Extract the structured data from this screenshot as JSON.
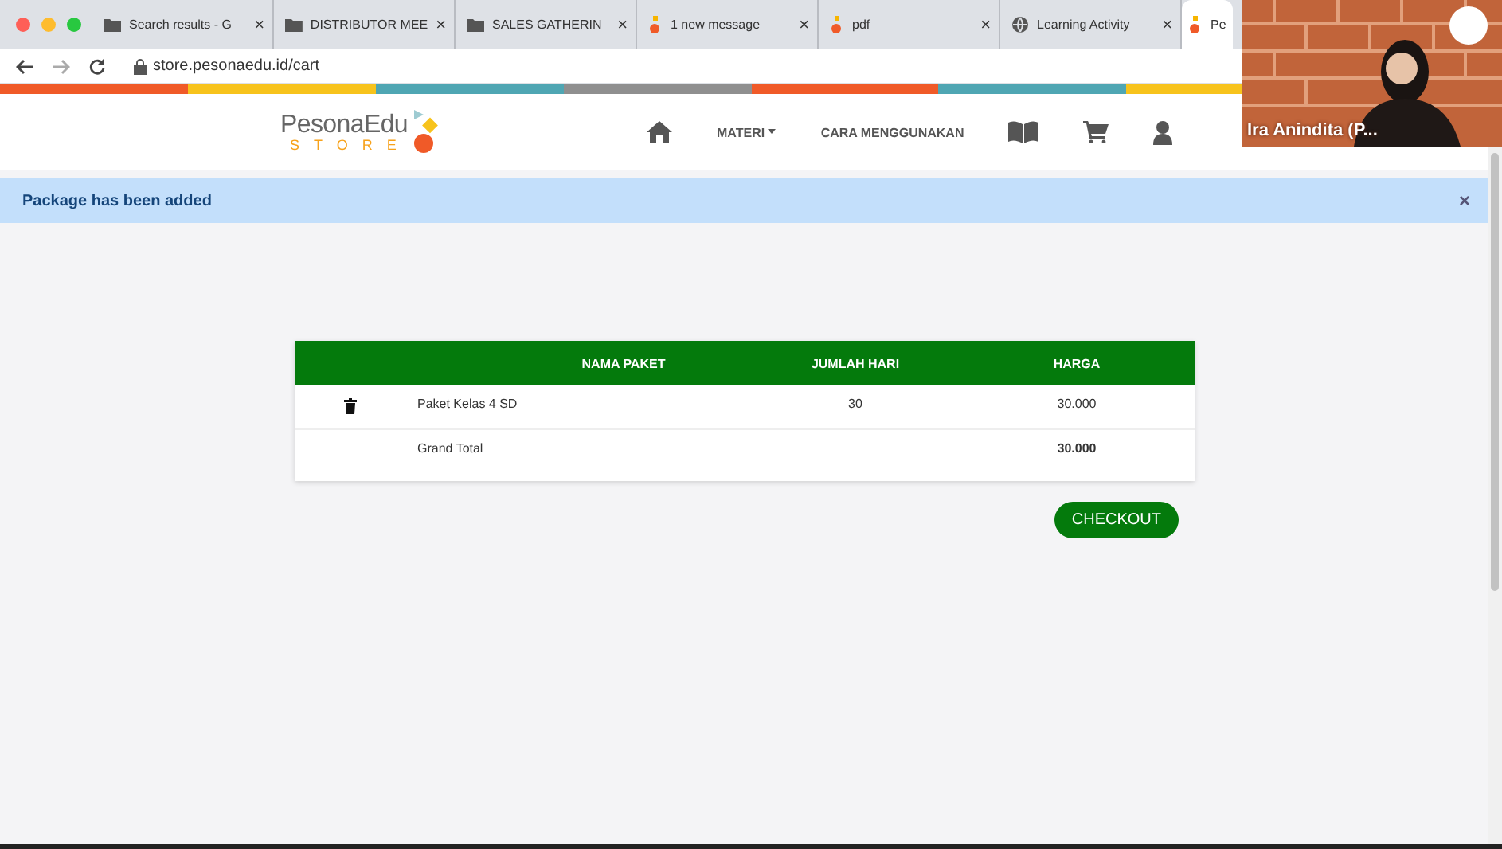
{
  "browser": {
    "tabs": [
      {
        "label": "Search results - G",
        "kind": "folder",
        "close": "×",
        "selected": false
      },
      {
        "label": "DISTRIBUTOR MEE",
        "kind": "folder",
        "close": "×",
        "selected": false
      },
      {
        "label": "SALES GATHERIN",
        "kind": "folder",
        "close": "×",
        "selected": false
      },
      {
        "label": "1 new message",
        "kind": "site",
        "close": "×",
        "selected": false
      },
      {
        "label": "pdf",
        "kind": "site",
        "close": "×",
        "selected": false
      },
      {
        "label": "Learning Activity",
        "kind": "globe",
        "close": "×",
        "selected": false
      },
      {
        "label": "Pe",
        "kind": "site",
        "selected": true
      }
    ],
    "url": "store.pesonaedu.id/cart"
  },
  "nav": {
    "logo": {
      "name": "PesonaEdu",
      "sub": "STORE"
    },
    "items": [
      {
        "kind": "home"
      },
      {
        "kind": "text",
        "label": "MATERI",
        "dropdown": true
      },
      {
        "kind": "text",
        "label": "CARA MENGGUNAKAN",
        "dropdown": false
      },
      {
        "kind": "book"
      },
      {
        "kind": "cart"
      },
      {
        "kind": "user"
      }
    ]
  },
  "alert": {
    "message": "Package has been added",
    "close": "×"
  },
  "cart": {
    "columns": [
      "NAMA PAKET",
      "JUMLAH HARI",
      "HARGA"
    ],
    "rows": [
      {
        "name": "Paket Kelas 4 SD",
        "days": "30",
        "price": "30.000"
      }
    ],
    "total_label": "Grand Total",
    "total": "30.000",
    "checkout": "CHECKOUT"
  },
  "video": {
    "participant": "Ira Anindita (P..."
  }
}
